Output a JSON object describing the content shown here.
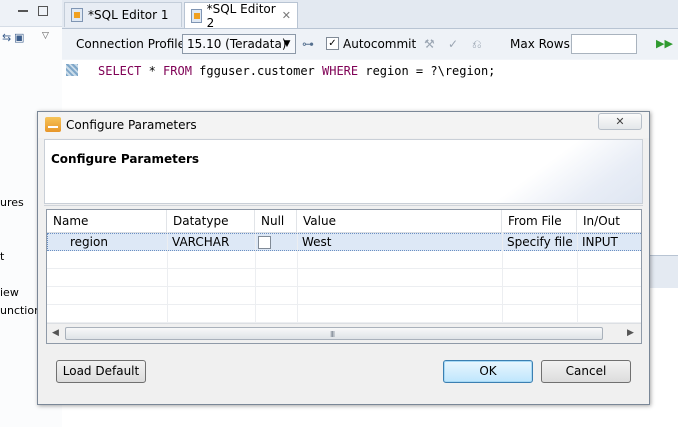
{
  "left_panel": {
    "partial_items": [
      "ures",
      "t",
      "iew",
      "unction"
    ]
  },
  "editor": {
    "tabs": [
      {
        "label": "*SQL Editor 1",
        "active": false
      },
      {
        "label": "*SQL Editor 2",
        "active": true
      }
    ],
    "toolbar": {
      "connection_label": "Connection Profile:",
      "connection_value": "15.10 (Teradata)",
      "autocommit_label": "Autocommit",
      "autocommit_checked": "✓",
      "max_rows_label": "Max Rows:",
      "max_rows_value": ""
    },
    "sql": {
      "kw1": "SELECT",
      "rest1": " * ",
      "kw2": "FROM",
      "rest2": " fgguser.customer ",
      "kw3": "WHERE",
      "rest3": " region = ?\\region;"
    }
  },
  "dialog": {
    "title": "Configure Parameters",
    "heading": "Configure Parameters",
    "columns": [
      "Name",
      "Datatype",
      "Null",
      "Value",
      "From File",
      "In/Out"
    ],
    "rows": [
      {
        "name": "region",
        "datatype": "VARCHAR",
        "null": false,
        "value": "West",
        "from_file": "Specify file",
        "in_out": "INPUT"
      }
    ],
    "scroll_grip": "III",
    "buttons": {
      "load_default": "Load Default",
      "ok": "OK",
      "cancel": "Cancel"
    }
  },
  "colors": {
    "sql_keyword": "#7f0055",
    "selection": "#dde8f6",
    "default_button": "#bee6fd"
  }
}
